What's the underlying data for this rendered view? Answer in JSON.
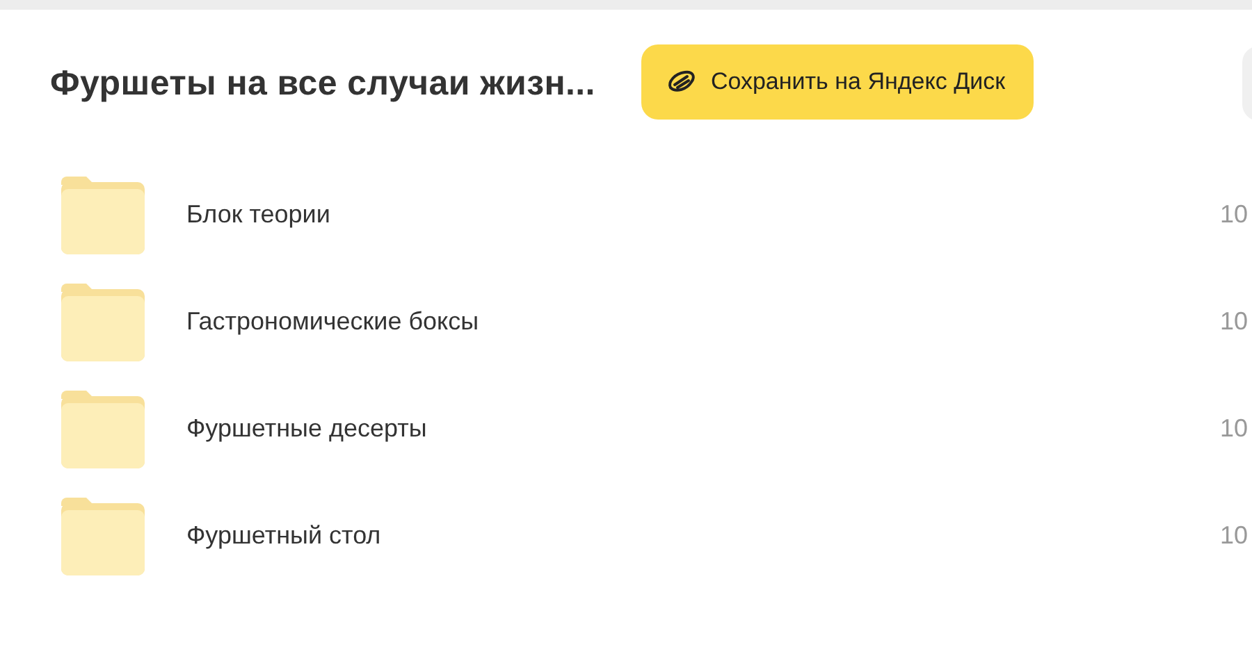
{
  "header": {
    "title": "Фуршеты на все случаи жизн...",
    "save_button": "Сохранить на Яндекс Диск"
  },
  "items": [
    {
      "kind": "folder",
      "name": "Блок теории",
      "column_2": "10"
    },
    {
      "kind": "folder",
      "name": "Гастрономические боксы",
      "column_2": "10"
    },
    {
      "kind": "folder",
      "name": "Фуршетные десерты",
      "column_2": "10"
    },
    {
      "kind": "folder",
      "name": "Фуршетный стол",
      "column_2": "10"
    }
  ]
}
